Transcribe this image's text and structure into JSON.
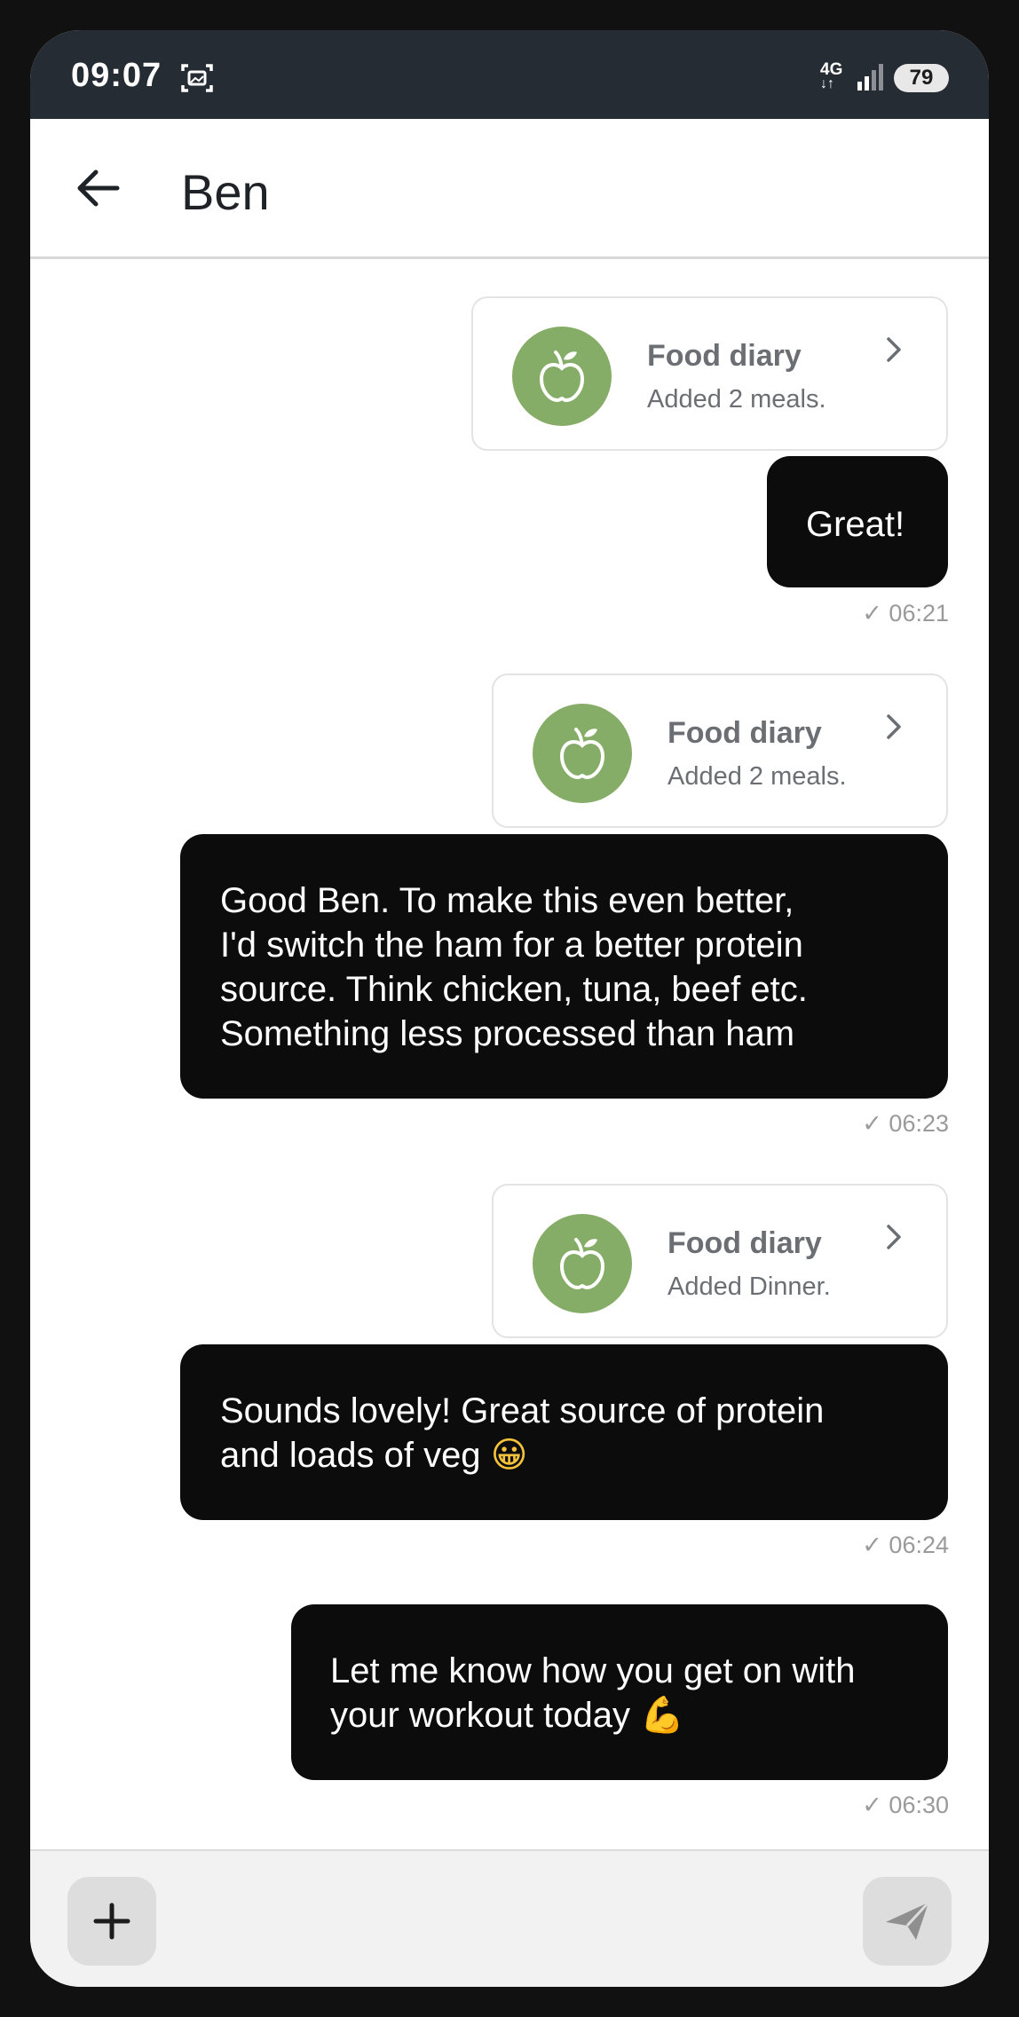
{
  "status_bar": {
    "time": "09:07",
    "network_top": "4G",
    "network_bottom": "↓↑",
    "battery": "79"
  },
  "header": {
    "title": "Ben",
    "back_icon": "arrow-left-icon"
  },
  "messages": [
    {
      "type": "food_card",
      "title": "Food diary",
      "subtitle": "Added 2 meals.",
      "icon": "apple-icon"
    },
    {
      "type": "bubble",
      "text": "Great!",
      "time": "✓ 06:21"
    },
    {
      "type": "food_card",
      "title": "Food diary",
      "subtitle": "Added 2 meals.",
      "icon": "apple-icon"
    },
    {
      "type": "bubble",
      "lines": [
        "Good Ben. To make this even better,",
        "I'd switch the ham for a better protein",
        "source. Think chicken, tuna, beef etc.",
        "Something less processed than ham"
      ],
      "time": "✓ 06:23"
    },
    {
      "type": "food_card",
      "title": "Food diary",
      "subtitle": "Added Dinner.",
      "icon": "apple-icon"
    },
    {
      "type": "bubble",
      "lines": [
        "Sounds lovely! Great source of protein",
        "and loads of veg"
      ],
      "emoji": "😀",
      "time": "✓ 06:24"
    },
    {
      "type": "bubble",
      "lines": [
        "Let me know how you get on with",
        "your workout today"
      ],
      "emoji": "💪",
      "time": "✓ 06:30"
    }
  ],
  "composer": {
    "add_icon": "plus-icon",
    "send_icon": "send-icon"
  },
  "colors": {
    "status_bar_bg": "#262c33",
    "bubble_bg": "#0c0c0c",
    "apple_green": "#86ad67",
    "composer_bg": "#f2f2f2"
  }
}
